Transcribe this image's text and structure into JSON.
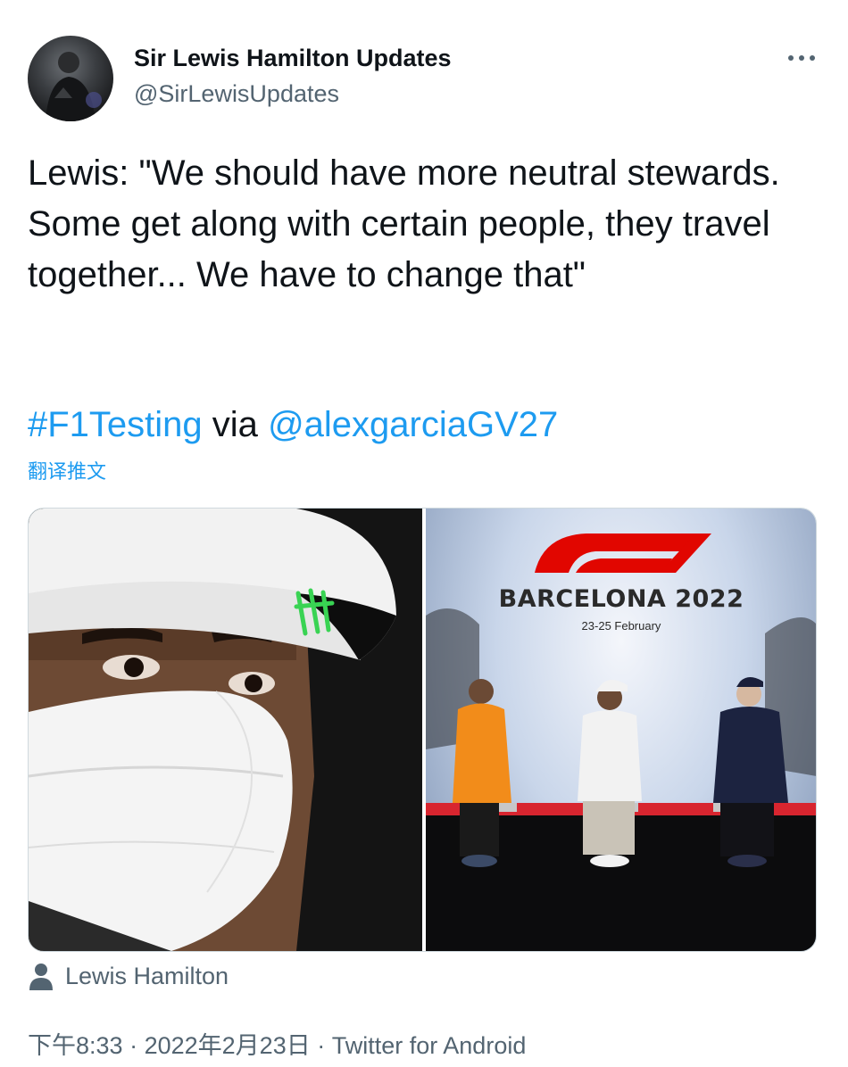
{
  "author": {
    "display_name": "Sir Lewis Hamilton Updates",
    "handle": "@SirLewisUpdates"
  },
  "tweet": {
    "text": "Lewis: \"We should have more neutral stewards. Some get along with certain people, they travel together... We have to change that\"",
    "hashtag": "#F1Testing",
    "via_word": "via",
    "mention": "@alexgarciaGV27",
    "translate_label": "翻译推文"
  },
  "media": {
    "right_photo": {
      "banner_title": "BARCELONA 2022",
      "banner_dates": "23-25 February"
    },
    "tagged_person": "Lewis Hamilton"
  },
  "meta": {
    "time": "下午8:33",
    "separator": "·",
    "date": "2022年2月23日",
    "source": "Twitter for Android"
  },
  "icons": {
    "more": "more-dots-icon",
    "tag": "person-icon"
  },
  "colors": {
    "link": "#1d9bf0",
    "secondary_text": "#536471",
    "primary_text": "#0f1419",
    "f1_red": "#e10600"
  }
}
